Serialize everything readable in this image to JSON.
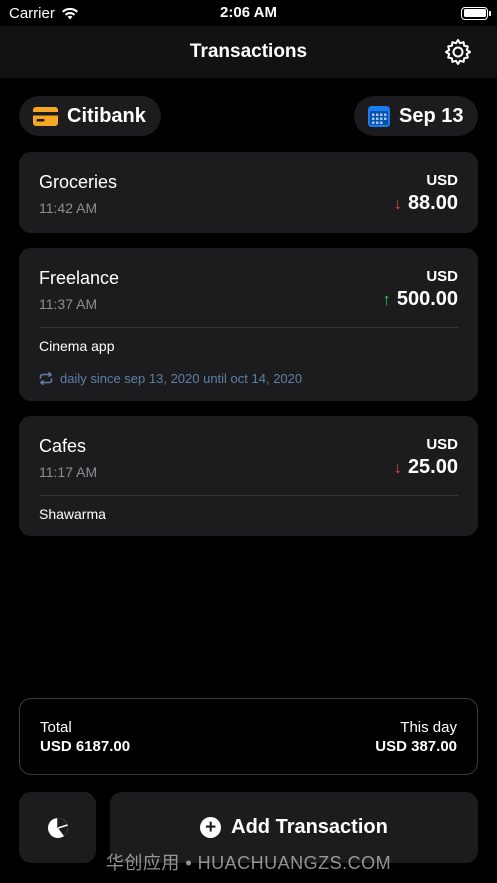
{
  "status_bar": {
    "carrier": "Carrier",
    "time": "2:06 AM"
  },
  "nav": {
    "title": "Transactions",
    "settings_icon": "gear-icon"
  },
  "filters": {
    "account": "Citibank",
    "date": "Sep 13"
  },
  "colors": {
    "accent_orange": "#f5a623",
    "accent_blue": "#1a7cf0",
    "expense": "#e0453a",
    "income": "#34c759",
    "repeat": "#5e7fa8"
  },
  "transactions": [
    {
      "title": "Groceries",
      "time": "11:42 AM",
      "currency": "USD",
      "amount": "88.00",
      "direction": "down"
    },
    {
      "title": "Freelance",
      "time": "11:37 AM",
      "currency": "USD",
      "amount": "500.00",
      "direction": "up",
      "note": "Cinema app",
      "repeat": "daily since sep 13, 2020 until oct 14, 2020"
    },
    {
      "title": "Cafes",
      "time": "11:17 AM",
      "currency": "USD",
      "amount": "25.00",
      "direction": "down",
      "note": "Shawarma"
    }
  ],
  "summary": {
    "total_label": "Total",
    "total_value": "USD 6187.00",
    "day_label": "This day",
    "day_value": "USD 387.00"
  },
  "actions": {
    "add_label": "Add Transaction"
  },
  "watermark": "华创应用 • HUACHUANGZS.COM"
}
